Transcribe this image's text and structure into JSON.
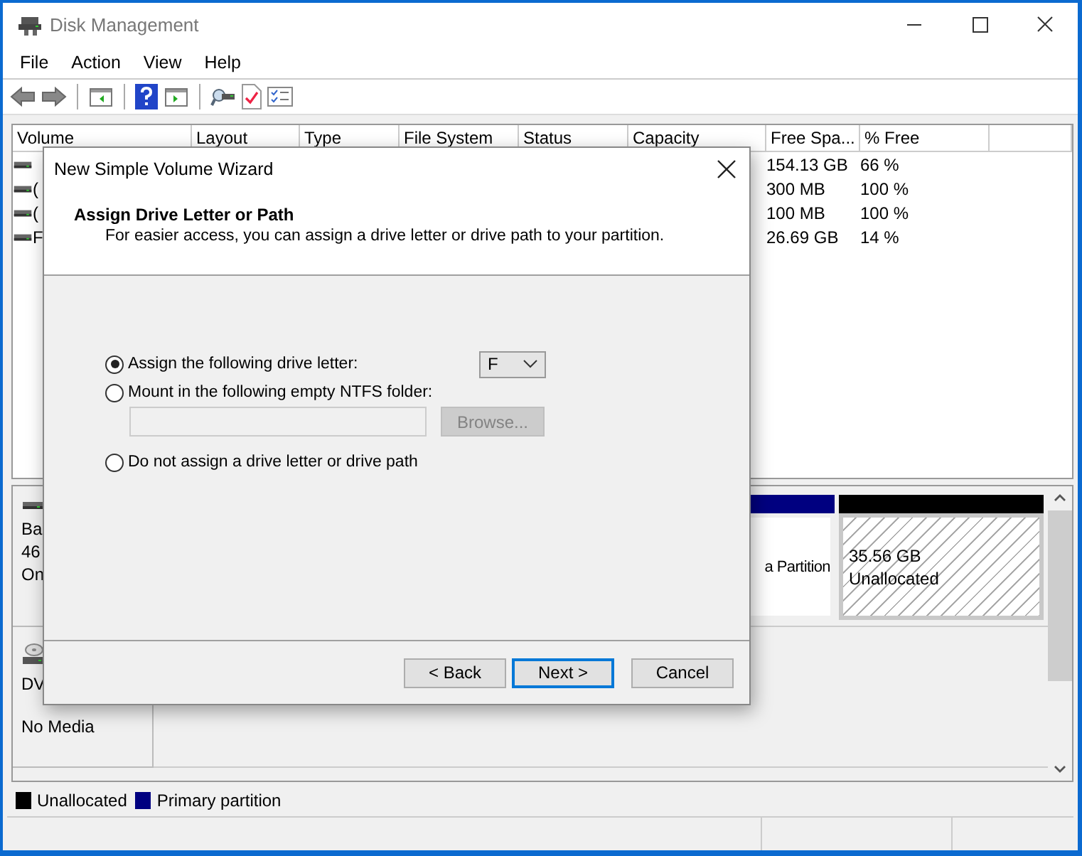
{
  "window": {
    "title": "Disk Management"
  },
  "menu": [
    {
      "label": "File"
    },
    {
      "label": "Action"
    },
    {
      "label": "View"
    },
    {
      "label": "Help"
    }
  ],
  "volume_list": {
    "columns": [
      "Volume",
      "Layout",
      "Type",
      "File System",
      "Status",
      "Capacity",
      "Free Spa...",
      "% Free"
    ],
    "rows": [
      {
        "free_space": "154.13 GB",
        "percent_free": "66 %"
      },
      {
        "volume": "(",
        "free_space": "300 MB",
        "percent_free": "100 %"
      },
      {
        "volume": "(",
        "free_space": "100 MB",
        "percent_free": "100 %"
      },
      {
        "volume": "F",
        "free_space": "26.69 GB",
        "percent_free": "14 %"
      }
    ]
  },
  "disks": [
    {
      "kind": "disk",
      "label_lines": [
        "Ba",
        "46",
        "On"
      ],
      "partitions": [
        {
          "kind": "primary",
          "lines": [
            "a Partition"
          ]
        },
        {
          "kind": "unallocated",
          "lines": [
            "35.56 GB",
            "Unallocated"
          ]
        }
      ]
    },
    {
      "kind": "dvd",
      "label_lines": [
        "DV",
        "No Media"
      ]
    }
  ],
  "legend": [
    {
      "label": "Unallocated",
      "color": "#000000"
    },
    {
      "label": "Primary partition",
      "color": "#000080"
    }
  ],
  "dialog": {
    "title": "New Simple Volume Wizard",
    "heading": "Assign Drive Letter or Path",
    "subtitle": "For easier access, you can assign a drive letter or drive path to your partition.",
    "options": [
      {
        "kind": "letter",
        "label": "Assign the following drive letter:",
        "selected": true,
        "value": "F"
      },
      {
        "kind": "folder",
        "label": "Mount in the following empty NTFS folder:",
        "selected": false,
        "field_disabled": true,
        "browse": {
          "label": "Browse...",
          "disabled": true
        }
      },
      {
        "kind": "none",
        "label": "Do not assign a drive letter or drive path",
        "selected": false
      }
    ],
    "buttons": [
      {
        "label": "< Back",
        "focused": false
      },
      {
        "label": "Next >",
        "focused": true
      },
      {
        "label": "Cancel",
        "focused": false
      }
    ]
  }
}
